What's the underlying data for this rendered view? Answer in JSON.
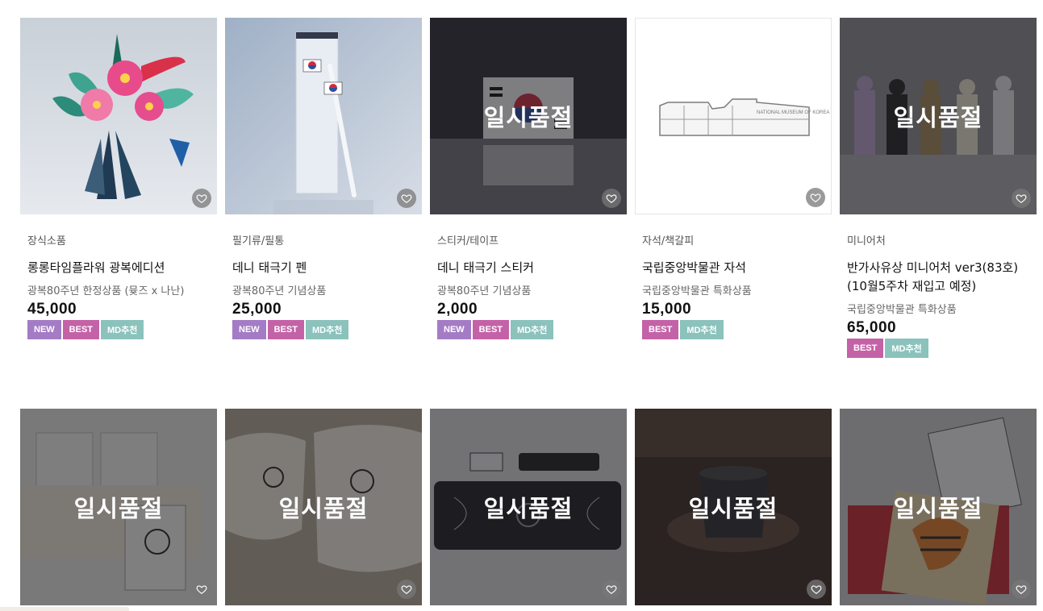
{
  "products": [
    {
      "category": "장식소품",
      "name": "롱롱타임플라워 광복에디션",
      "sub": "광복80주년 한정상품 (뮺즈 x 나난)",
      "price": "45,000",
      "badges": [
        "NEW",
        "BEST",
        "MD추천"
      ],
      "soldout": ""
    },
    {
      "category": "필기류/필통",
      "name": "데니 태극기 펜",
      "sub": "광복80주년 기념상품",
      "price": "25,000",
      "badges": [
        "NEW",
        "BEST",
        "MD추천"
      ],
      "soldout": ""
    },
    {
      "category": "스티커/테이프",
      "name": "데니 태극기 스티커",
      "sub": "광복80주년 기념상품",
      "price": "2,000",
      "badges": [
        "NEW",
        "BEST",
        "MD추천"
      ],
      "soldout": "일시품절"
    },
    {
      "category": "자석/책갈피",
      "name": "국립중앙박물관 자석",
      "sub": "국립중앙박물관 특화상품",
      "price": "15,000",
      "badges": [
        "BEST",
        "MD추천"
      ],
      "soldout": ""
    },
    {
      "category": "미니어처",
      "name": "반가사유상 미니어처 ver3(83호)(10월5주차 재입고 예정)",
      "sub": "국립중앙박물관 특화상품",
      "price": "65,000",
      "badges": [
        "BEST",
        "MD추천"
      ],
      "soldout": "일시품절"
    },
    {
      "soldout": "일시품절"
    },
    {
      "soldout": "일시품절"
    },
    {
      "soldout": "일시품절"
    },
    {
      "soldout": "일시품절"
    },
    {
      "soldout": "일시품절"
    }
  ],
  "magnet_text": "NATIONAL MUSEUM OF KOREA",
  "colors": {
    "new": "#a47cc5",
    "best": "#c462a7",
    "md": "#8bc2bc"
  }
}
